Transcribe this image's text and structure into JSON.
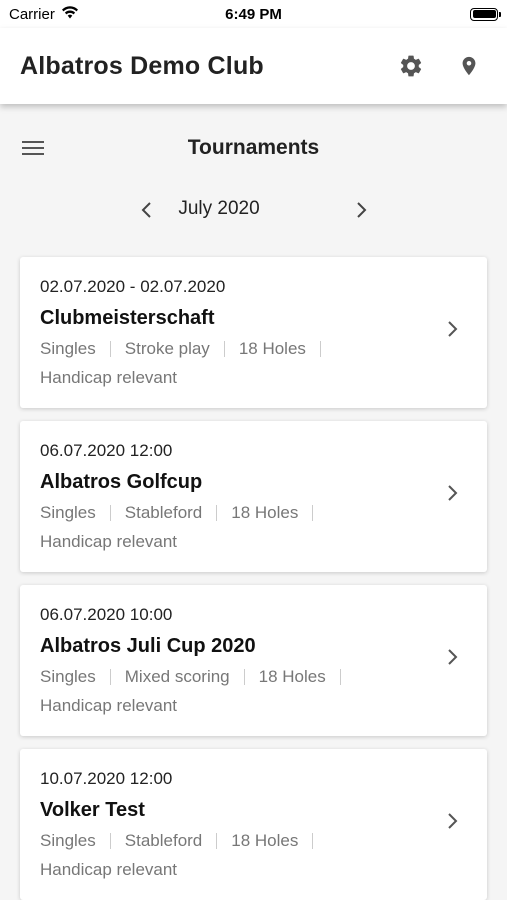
{
  "status_bar": {
    "carrier": "Carrier",
    "time": "6:49 PM"
  },
  "header": {
    "title": "Albatros Demo Club",
    "icons": [
      "gear-icon",
      "location-pin-icon"
    ]
  },
  "section": {
    "title": "Tournaments",
    "menu_icon": "hamburger-menu-icon"
  },
  "month_nav": {
    "label": "July 2020"
  },
  "tournaments": [
    {
      "date": "02.07.2020 - 02.07.2020",
      "name": "Clubmeisterschaft",
      "tags": [
        "Singles",
        "Stroke play",
        "18 Holes"
      ],
      "extra": "Handicap relevant"
    },
    {
      "date": "06.07.2020 12:00",
      "name": "Albatros Golfcup",
      "tags": [
        "Singles",
        "Stableford",
        "18 Holes"
      ],
      "extra": "Handicap relevant"
    },
    {
      "date": "06.07.2020 10:00",
      "name": "Albatros Juli Cup 2020",
      "tags": [
        "Singles",
        "Mixed scoring",
        "18 Holes"
      ],
      "extra": "Handicap relevant"
    },
    {
      "date": "10.07.2020 12:00",
      "name": "Volker Test",
      "tags": [
        "Singles",
        "Stableford",
        "18 Holes"
      ],
      "extra": "Handicap relevant"
    }
  ],
  "colors": {
    "background": "#f5f5f5",
    "card": "#ffffff",
    "text_primary": "#111111",
    "text_secondary": "#777777",
    "icon": "#555555"
  }
}
